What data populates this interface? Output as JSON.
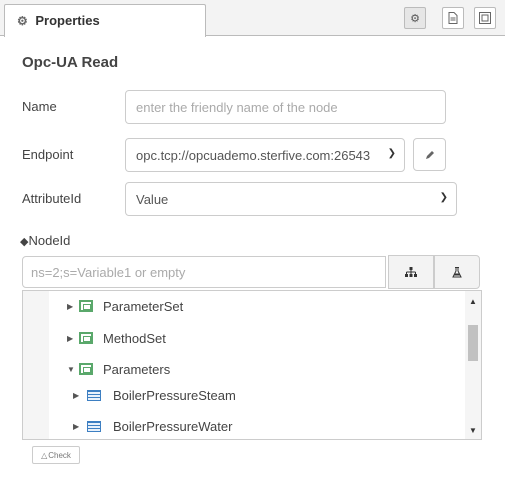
{
  "tab": {
    "icon": "gear-icon",
    "label": "Properties"
  },
  "toolbar": {
    "buttons": [
      "gear-icon",
      "document-icon",
      "frame-icon"
    ]
  },
  "title": "Opc-UA Read",
  "form": {
    "name": {
      "label": "Name",
      "placeholder": "enter the friendly name of the node",
      "value": ""
    },
    "endpoint": {
      "label": "Endpoint",
      "value": "opc.tcp://opcuademo.sterfive.com:26543"
    },
    "attribute": {
      "label": "AttributeId",
      "value": "Value"
    },
    "nodeid": {
      "label": "NodeId",
      "icon": "tag-icon",
      "placeholder": "ns=2;s=Variable1 or empty",
      "value": ""
    }
  },
  "tree": {
    "items": [
      {
        "label": "ParameterSet",
        "expanded": false,
        "icon": "object-icon"
      },
      {
        "label": "MethodSet",
        "expanded": false,
        "icon": "object-icon"
      },
      {
        "label": "Parameters",
        "expanded": true,
        "icon": "object-icon"
      },
      {
        "label": "BoilerPressureSteam",
        "expanded": false,
        "icon": "variable-icon"
      },
      {
        "label": "BoilerPressureWater",
        "expanded": false,
        "icon": "variable-icon"
      }
    ]
  },
  "check_label": "Check",
  "colors": {
    "accent_object": "#5aa86b",
    "accent_variable": "#3d7fc2"
  }
}
